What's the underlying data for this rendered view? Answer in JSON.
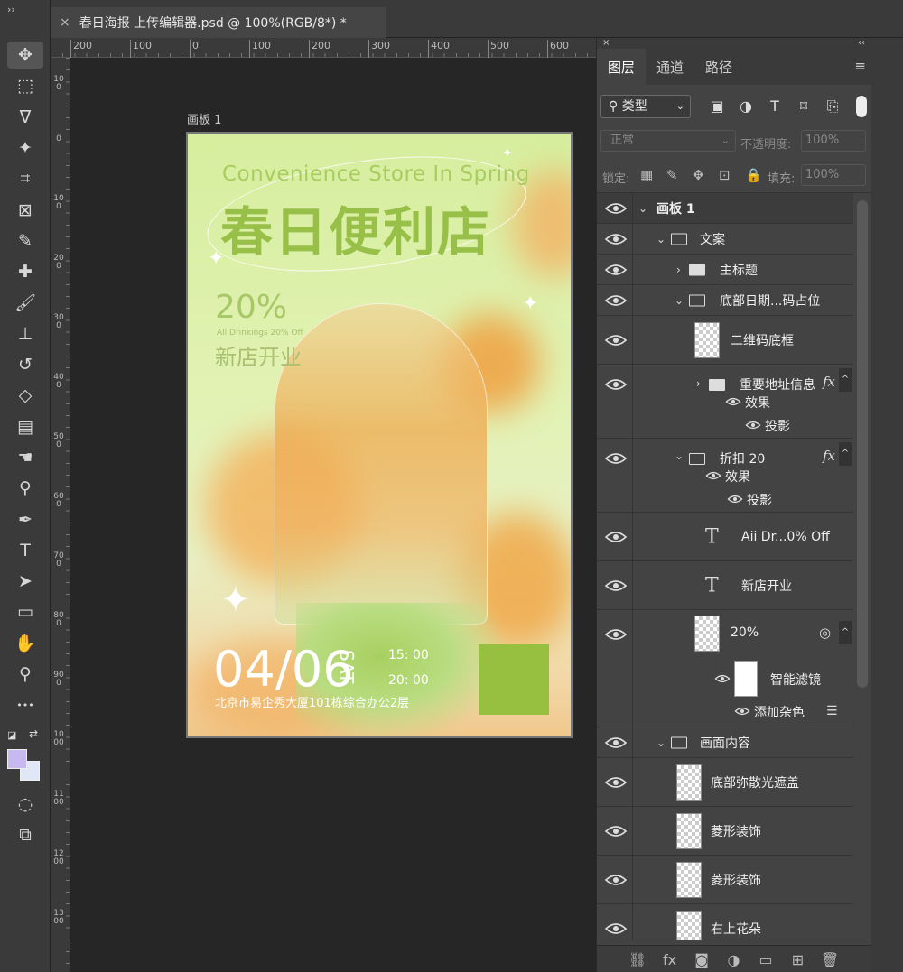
{
  "app": {
    "collapse_glyph": "››",
    "document_tab": {
      "close": "×",
      "title": "春日海报 上传编辑器.psd @ 100%(RGB/8*) *"
    }
  },
  "toolbar": {
    "tools": [
      {
        "name": "move-tool-icon",
        "glyph": "✥",
        "active": true
      },
      {
        "name": "marquee-tool-icon",
        "glyph": "⬚"
      },
      {
        "name": "lasso-tool-icon",
        "glyph": "ᐁ"
      },
      {
        "name": "magic-wand-tool-icon",
        "glyph": "✦"
      },
      {
        "name": "crop-tool-icon",
        "glyph": "⌗"
      },
      {
        "name": "frame-tool-icon",
        "glyph": "⊠"
      },
      {
        "name": "eyedropper-tool-icon",
        "glyph": "✎"
      },
      {
        "name": "healing-brush-tool-icon",
        "glyph": "✚"
      },
      {
        "name": "brush-tool-icon",
        "glyph": "🖌"
      },
      {
        "name": "stamp-tool-icon",
        "glyph": "⊥"
      },
      {
        "name": "history-brush-tool-icon",
        "glyph": "↺"
      },
      {
        "name": "eraser-tool-icon",
        "glyph": "◇"
      },
      {
        "name": "gradient-tool-icon",
        "glyph": "▤"
      },
      {
        "name": "smudge-tool-icon",
        "glyph": "☚"
      },
      {
        "name": "dodge-tool-icon",
        "glyph": "⚲"
      },
      {
        "name": "pen-tool-icon",
        "glyph": "✒"
      },
      {
        "name": "type-tool-icon",
        "glyph": "T"
      },
      {
        "name": "path-selection-tool-icon",
        "glyph": "➤"
      },
      {
        "name": "rectangle-tool-icon",
        "glyph": "▭"
      },
      {
        "name": "hand-tool-icon",
        "glyph": "✋"
      },
      {
        "name": "zoom-tool-icon",
        "glyph": "⚲"
      },
      {
        "name": "more-tools-icon",
        "glyph": "•••"
      }
    ],
    "extra": [
      {
        "name": "quick-mask-icon",
        "glyph": "◌"
      },
      {
        "name": "screen-mode-icon",
        "glyph": "⧉"
      }
    ],
    "foreground_color": "#c8b8f0",
    "background_color": "#e0e8f8",
    "reset_glyph": "◪",
    "swap_glyph": "⇄"
  },
  "rulers": {
    "horizontal": [
      "200",
      "100",
      "0",
      "100",
      "200",
      "300",
      "400",
      "500",
      "600"
    ],
    "vertical": [
      "100",
      "0",
      "100",
      "200",
      "300",
      "400",
      "500",
      "600",
      "700",
      "800",
      "900",
      "1000",
      "1100",
      "1200",
      "1300"
    ]
  },
  "canvas": {
    "artboard_label": "画板 1",
    "poster": {
      "subtitle": "Convenience Store In Spring",
      "title": "春日便利店",
      "discount": "20%",
      "discount_small": "All Drinkings 20% Off",
      "opening": "新店开业",
      "date": "04/06",
      "weekday": "SAT",
      "time_start": "15: 00",
      "time_end": "20: 00",
      "address": "北京市易企秀大厦101栋综合办公2层",
      "sparkle_glyph": "✦",
      "qr_color": "#98c040"
    }
  },
  "layers_panel": {
    "close": "×",
    "collapse": "‹‹",
    "tabs": [
      "图层",
      "通道",
      "路径"
    ],
    "menu_glyph": "≡",
    "filter": {
      "kind": "类型",
      "icons": [
        {
          "name": "pixel-filter-icon",
          "glyph": "▣"
        },
        {
          "name": "adjustment-filter-icon",
          "glyph": "◑"
        },
        {
          "name": "type-filter-icon",
          "glyph": "T"
        },
        {
          "name": "shape-filter-icon",
          "glyph": "⌑"
        },
        {
          "name": "smart-object-filter-icon",
          "glyph": "⎘"
        }
      ]
    },
    "blend_mode": "正常",
    "opacity_label": "不透明度:",
    "opacity_value": "100%",
    "lock_label": "锁定:",
    "lock_icons": [
      {
        "name": "lock-transparent-icon",
        "glyph": "▦"
      },
      {
        "name": "lock-pixels-icon",
        "glyph": "✎"
      },
      {
        "name": "lock-position-icon",
        "glyph": "✥"
      },
      {
        "name": "lock-artboard-icon",
        "glyph": "⊡"
      },
      {
        "name": "lock-all-icon",
        "glyph": "🔒"
      }
    ],
    "fill_label": "填充:",
    "fill_value": "100%",
    "layers": {
      "artboard": "画板 1",
      "copy_group": "文案",
      "main_title": "主标题",
      "bottom_date_group": "底部日期...码占位",
      "qr_frame": "二维码底框",
      "address_group": "重要地址信息",
      "effects": "效果",
      "drop_shadow": "投影",
      "discount_group": "折扣 20",
      "effects_2": "效果",
      "drop_shadow_2": "投影",
      "text_off": "Aii Dr...0% Off",
      "text_opening": "新店开业",
      "smart_20": "20%",
      "smart_filters": "智能滤镜",
      "add_noise": "添加杂色",
      "content_group": "画面内容",
      "bottom_glow_mask": "底部弥散光遮盖",
      "diamond_1": "菱形装饰",
      "diamond_2": "菱形装饰",
      "top_right_flower": "右上花朵"
    },
    "glyphs": {
      "fx": "fx",
      "T": "T",
      "collapse_up": "^",
      "chevron_down": "⌄",
      "chevron_right": "›"
    },
    "bottom_icons": [
      {
        "name": "link-layers-icon",
        "glyph": "⛓"
      },
      {
        "name": "layer-style-icon",
        "glyph": "fx"
      },
      {
        "name": "add-mask-icon",
        "glyph": "◙"
      },
      {
        "name": "adjustment-layer-icon",
        "glyph": "◑"
      },
      {
        "name": "new-group-icon",
        "glyph": "▭"
      },
      {
        "name": "new-layer-icon",
        "glyph": "⊞"
      },
      {
        "name": "delete-layer-icon",
        "glyph": "🗑"
      }
    ]
  }
}
